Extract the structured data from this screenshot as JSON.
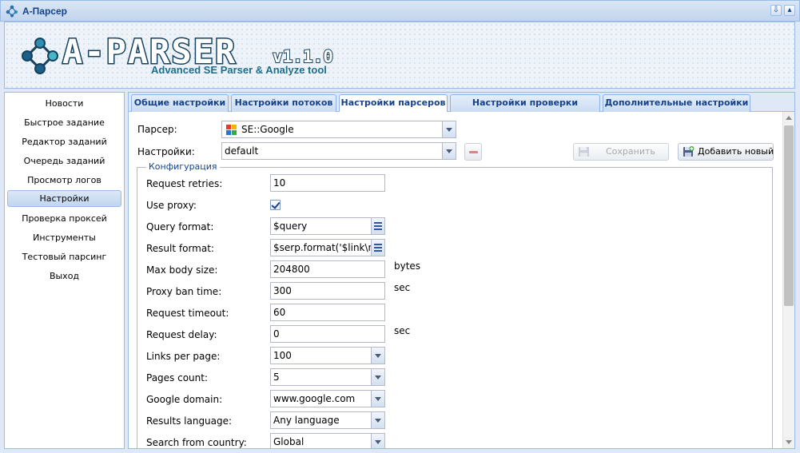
{
  "window": {
    "title": "A-Парсер"
  },
  "brand": {
    "name": "A-PARSER",
    "version": "v1.1.0",
    "tagline": "Advanced SE Parser & Analyze tool"
  },
  "sidebar": {
    "items": [
      {
        "label": "Новости",
        "active": false
      },
      {
        "label": "Быстрое задание",
        "active": false
      },
      {
        "label": "Редактор заданий",
        "active": false
      },
      {
        "label": "Очередь заданий",
        "active": false
      },
      {
        "label": "Просмотр логов",
        "active": false
      },
      {
        "label": "Настройки",
        "active": true
      },
      {
        "label": "Проверка проксей",
        "active": false
      },
      {
        "label": "Инструменты",
        "active": false
      },
      {
        "label": "Тестовый парсинг",
        "active": false
      },
      {
        "label": "Выход",
        "active": false
      }
    ]
  },
  "tabs": [
    {
      "label": "Общие настройки",
      "active": false
    },
    {
      "label": "Настройки потоков",
      "active": false
    },
    {
      "label": "Настройки парсеров",
      "active": true
    },
    {
      "label": "Настройки проверки проксей",
      "active": false
    },
    {
      "label": "Дополнительные настройки",
      "active": false
    }
  ],
  "form": {
    "parser_label": "Парсер:",
    "parser_value": "SE::Google",
    "settings_label": "Настройки:",
    "settings_value": "default",
    "save_label": "Сохранить",
    "add_new_label": "Добавить новый",
    "config_legend": "Конфигурация",
    "rows": {
      "request_retries": {
        "label": "Request retries:",
        "value": "10"
      },
      "use_proxy": {
        "label": "Use proxy:",
        "checked": true
      },
      "query_format": {
        "label": "Query format:",
        "value": "$query"
      },
      "result_format": {
        "label": "Result format:",
        "value": "$serp.format('$link\\n')"
      },
      "max_body_size": {
        "label": "Max body size:",
        "value": "204800",
        "unit": "bytes"
      },
      "proxy_ban_time": {
        "label": "Proxy ban time:",
        "value": "300",
        "unit": "sec"
      },
      "request_timeout": {
        "label": "Request timeout:",
        "value": "60"
      },
      "request_delay": {
        "label": "Request delay:",
        "value": "0",
        "unit": "sec"
      },
      "links_per_page": {
        "label": "Links per page:",
        "value": "100"
      },
      "pages_count": {
        "label": "Pages count:",
        "value": "5"
      },
      "google_domain": {
        "label": "Google domain:",
        "value": "www.google.com"
      },
      "results_language": {
        "label": "Results language:",
        "value": "Any language"
      },
      "search_from_country": {
        "label": "Search from country:",
        "value": "Global"
      }
    }
  },
  "colors": {
    "accent": "#15428b",
    "border": "#99bbe8",
    "background": "#dfe8f6"
  }
}
